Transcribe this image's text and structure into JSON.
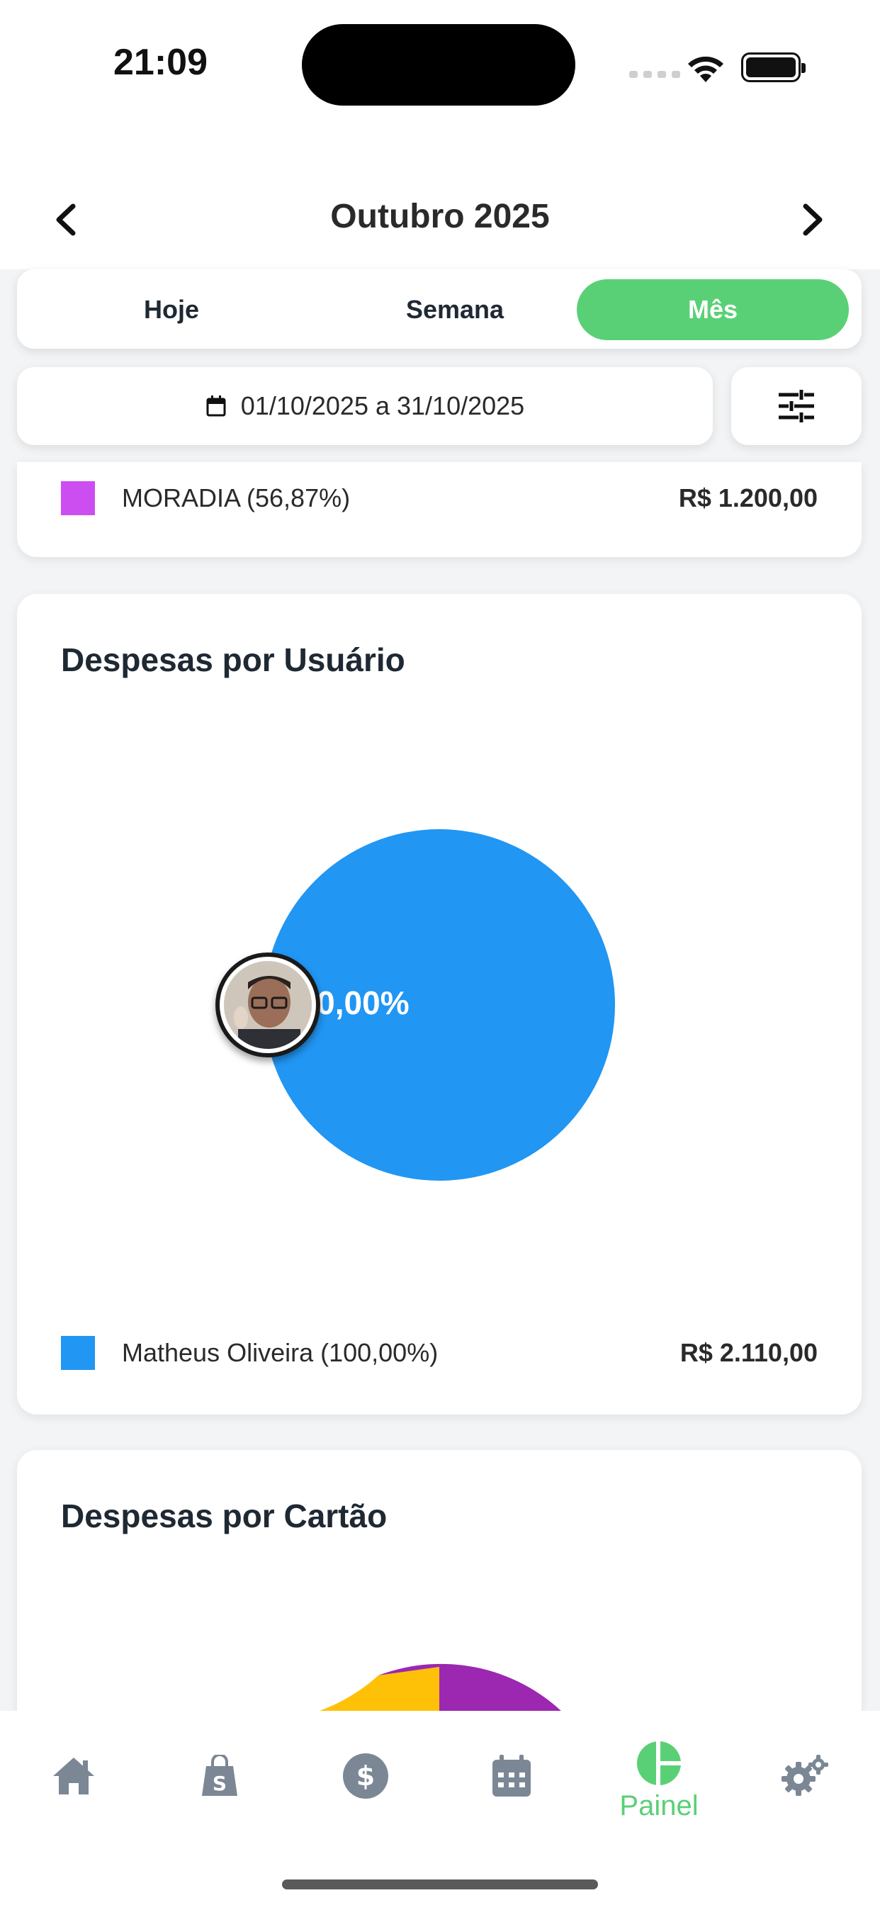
{
  "status_bar": {
    "time": "21:09"
  },
  "header": {
    "month_title": "Outubro 2025"
  },
  "period_tabs": [
    {
      "label": "Hoje",
      "active": false
    },
    {
      "label": "Semana",
      "active": false
    },
    {
      "label": "Mês",
      "active": true
    }
  ],
  "date_range": {
    "text": "01/10/2025 a 31/10/2025"
  },
  "category_card": {
    "legend": [
      {
        "label": "MORADIA (56,87%)",
        "value": "R$ 1.200,00",
        "color": "#cd4ef0"
      }
    ]
  },
  "user_card": {
    "title": "Despesas por Usuário",
    "chart_data": {
      "type": "pie",
      "slices": [
        {
          "label": "Matheus Oliveira",
          "percent": 100.0,
          "value": 2110.0,
          "color": "#2196f3"
        }
      ],
      "slice_label": "100,00%"
    },
    "legend": [
      {
        "label": "Matheus Oliveira (100,00%)",
        "value": "R$ 2.110,00",
        "color": "#2196f3"
      }
    ]
  },
  "card_card": {
    "title": "Despesas por Cartão",
    "visible_colors": [
      "#ffc107",
      "#9c27b0"
    ]
  },
  "bottom_nav": {
    "items": [
      {
        "name": "home",
        "label": ""
      },
      {
        "name": "shop",
        "label": ""
      },
      {
        "name": "money",
        "label": ""
      },
      {
        "name": "calendar",
        "label": ""
      },
      {
        "name": "painel",
        "label": "Painel",
        "active": true
      },
      {
        "name": "settings",
        "label": ""
      }
    ],
    "active_color": "#5ad076",
    "inactive_color": "#7b8794"
  }
}
